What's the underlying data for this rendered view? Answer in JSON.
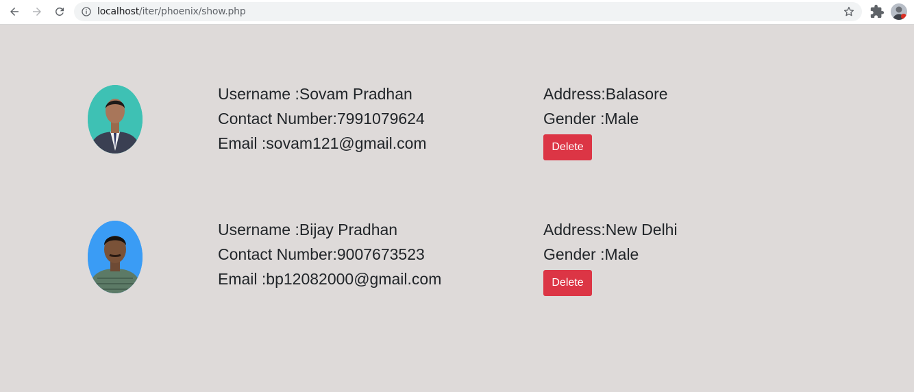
{
  "browser": {
    "url_host": "localhost",
    "url_path": "/iter/phoenix/show.php"
  },
  "records": [
    {
      "username_label": "Username :",
      "username": "Sovam Pradhan",
      "contact_label": "Contact Number:",
      "contact": "7991079624",
      "email_label": "Email :",
      "email": "sovam121@gmail.com",
      "address_label": "Address:",
      "address": "Balasore",
      "gender_label": "Gender :",
      "gender": "Male",
      "delete_label": "Delete",
      "avatar_bg": "#3ec1b4"
    },
    {
      "username_label": "Username :",
      "username": "Bijay Pradhan",
      "contact_label": "Contact Number:",
      "contact": "9007673523",
      "email_label": "Email :",
      "email": "bp12082000@gmail.com",
      "address_label": "Address:",
      "address": "New Delhi",
      "gender_label": "Gender :",
      "gender": "Male",
      "delete_label": "Delete",
      "avatar_bg": "#3a9cf5"
    }
  ],
  "colors": {
    "page_bg": "#dedad9",
    "delete_button": "#dc3545"
  }
}
